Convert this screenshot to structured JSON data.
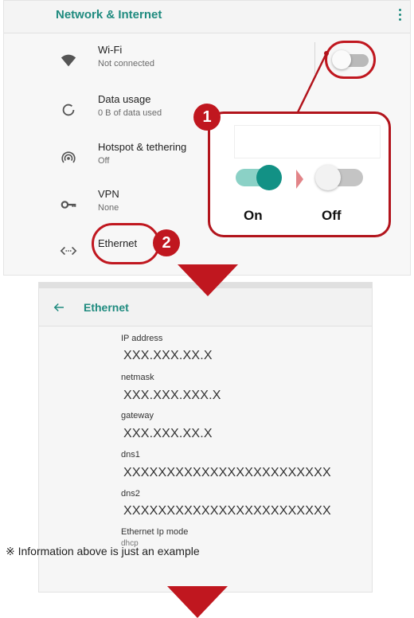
{
  "network": {
    "title": "Network & Internet",
    "items": [
      {
        "title": "Wi-Fi",
        "subtitle": "Not connected",
        "icon": "wifi-icon"
      },
      {
        "title": "Data usage",
        "subtitle": "0 B of data used",
        "icon": "data-usage-icon"
      },
      {
        "title": "Hotspot & tethering",
        "subtitle": "Off",
        "icon": "hotspot-icon"
      },
      {
        "title": "VPN",
        "subtitle": "None",
        "icon": "vpn-key-icon"
      },
      {
        "title": "Ethernet",
        "subtitle": "",
        "icon": "ethernet-icon"
      }
    ],
    "wifi_toggle_on": false
  },
  "callout": {
    "step1": "1",
    "step2": "2",
    "on_label": "On",
    "off_label": "Off"
  },
  "ethernet": {
    "title": "Ethernet",
    "fields": [
      {
        "label": "IP address",
        "value": "XXX.XXX.XX.X"
      },
      {
        "label": "netmask",
        "value": "XXX.XXX.XXX.X"
      },
      {
        "label": "gateway",
        "value": "XXX.XXX.XX.X"
      },
      {
        "label": "dns1",
        "value": "XXXXXXXXXXXXXXXXXXXXXXXX"
      },
      {
        "label": "dns2",
        "value": "XXXXXXXXXXXXXXXXXXXXXXXX"
      },
      {
        "label": "Ethernet Ip mode",
        "value": "dhcp"
      }
    ]
  },
  "note": "※ Information above is just an example",
  "colors": {
    "accent": "#1f8b7f",
    "highlight": "#c0171f",
    "toggle_on": "#129185"
  }
}
